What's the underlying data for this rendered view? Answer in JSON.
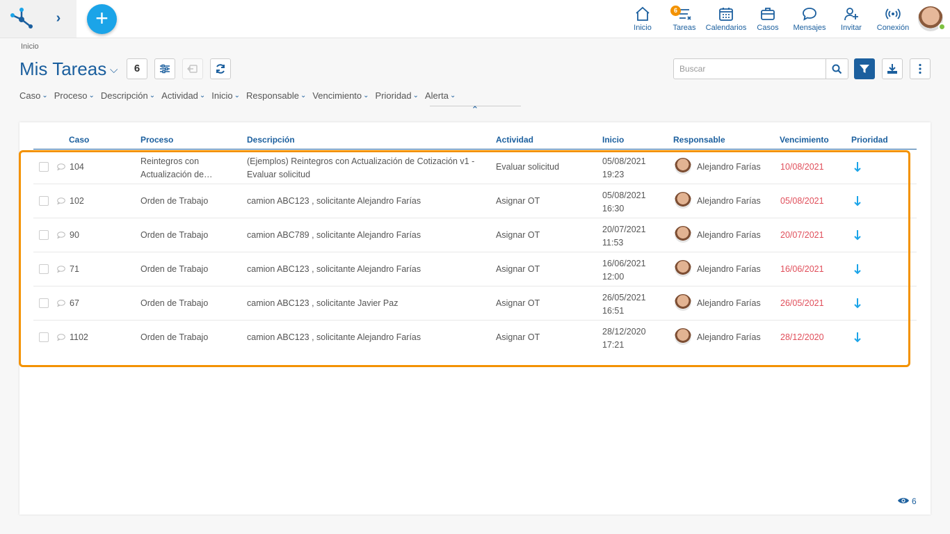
{
  "nav": {
    "items": [
      {
        "label": "Inicio",
        "icon": "home-icon"
      },
      {
        "label": "Tareas",
        "icon": "tasks-icon",
        "badge": "6"
      },
      {
        "label": "Calendarios",
        "icon": "calendar-icon"
      },
      {
        "label": "Casos",
        "icon": "briefcase-icon"
      },
      {
        "label": "Mensajes",
        "icon": "chat-icon"
      },
      {
        "label": "Invitar",
        "icon": "add-user-icon"
      },
      {
        "label": "Conexión",
        "icon": "broadcast-icon"
      }
    ]
  },
  "header": {
    "breadcrumb": "Inicio",
    "title": "Mis Tareas",
    "count": "6",
    "search_placeholder": "Buscar"
  },
  "column_filters": [
    "Caso",
    "Proceso",
    "Descripción",
    "Actividad",
    "Inicio",
    "Responsable",
    "Vencimiento",
    "Prioridad",
    "Alerta"
  ],
  "table": {
    "headers": {
      "caso": "Caso",
      "proceso": "Proceso",
      "descripcion": "Descripción",
      "actividad": "Actividad",
      "inicio": "Inicio",
      "responsable": "Responsable",
      "vencimiento": "Vencimiento",
      "prioridad": "Prioridad"
    },
    "rows": [
      {
        "caso": "104",
        "proceso": "Reintegros con Actualización de…",
        "descripcion": "(Ejemplos) Reintegros con Actualización de Cotización v1 - Evaluar solicitud",
        "actividad": "Evaluar solicitud",
        "inicio": "05/08/2021 19:23",
        "responsable": "Alejandro Farías",
        "vencimiento": "10/08/2021"
      },
      {
        "caso": "102",
        "proceso": "Orden de Trabajo",
        "descripcion": "camion ABC123 , solicitante Alejandro Farías",
        "actividad": "Asignar OT",
        "inicio": "05/08/2021 16:30",
        "responsable": "Alejandro Farías",
        "vencimiento": "05/08/2021"
      },
      {
        "caso": "90",
        "proceso": "Orden de Trabajo",
        "descripcion": "camion ABC789 , solicitante Alejandro Farías",
        "actividad": "Asignar OT",
        "inicio": "20/07/2021 11:53",
        "responsable": "Alejandro Farías",
        "vencimiento": "20/07/2021"
      },
      {
        "caso": "71",
        "proceso": "Orden de Trabajo",
        "descripcion": "camion ABC123 , solicitante Alejandro Farías",
        "actividad": "Asignar OT",
        "inicio": "16/06/2021 12:00",
        "responsable": "Alejandro Farías",
        "vencimiento": "16/06/2021"
      },
      {
        "caso": "67",
        "proceso": "Orden de Trabajo",
        "descripcion": "camion ABC123 , solicitante Javier Paz",
        "actividad": "Asignar OT",
        "inicio": "26/05/2021 16:51",
        "responsable": "Alejandro Farías",
        "vencimiento": "26/05/2021"
      },
      {
        "caso": "1102",
        "proceso": "Orden de Trabajo",
        "descripcion": "camion ABC123 , solicitante Alejandro Farías",
        "actividad": "Asignar OT",
        "inicio": "28/12/2020 17:21",
        "responsable": "Alejandro Farías",
        "vencimiento": "28/12/2020"
      }
    ]
  },
  "footer": {
    "visible_count": "6"
  },
  "colors": {
    "primary": "#1b5f9e",
    "accent": "#1ba4e8",
    "highlight": "#f39200",
    "overdue": "#e04e5a"
  }
}
